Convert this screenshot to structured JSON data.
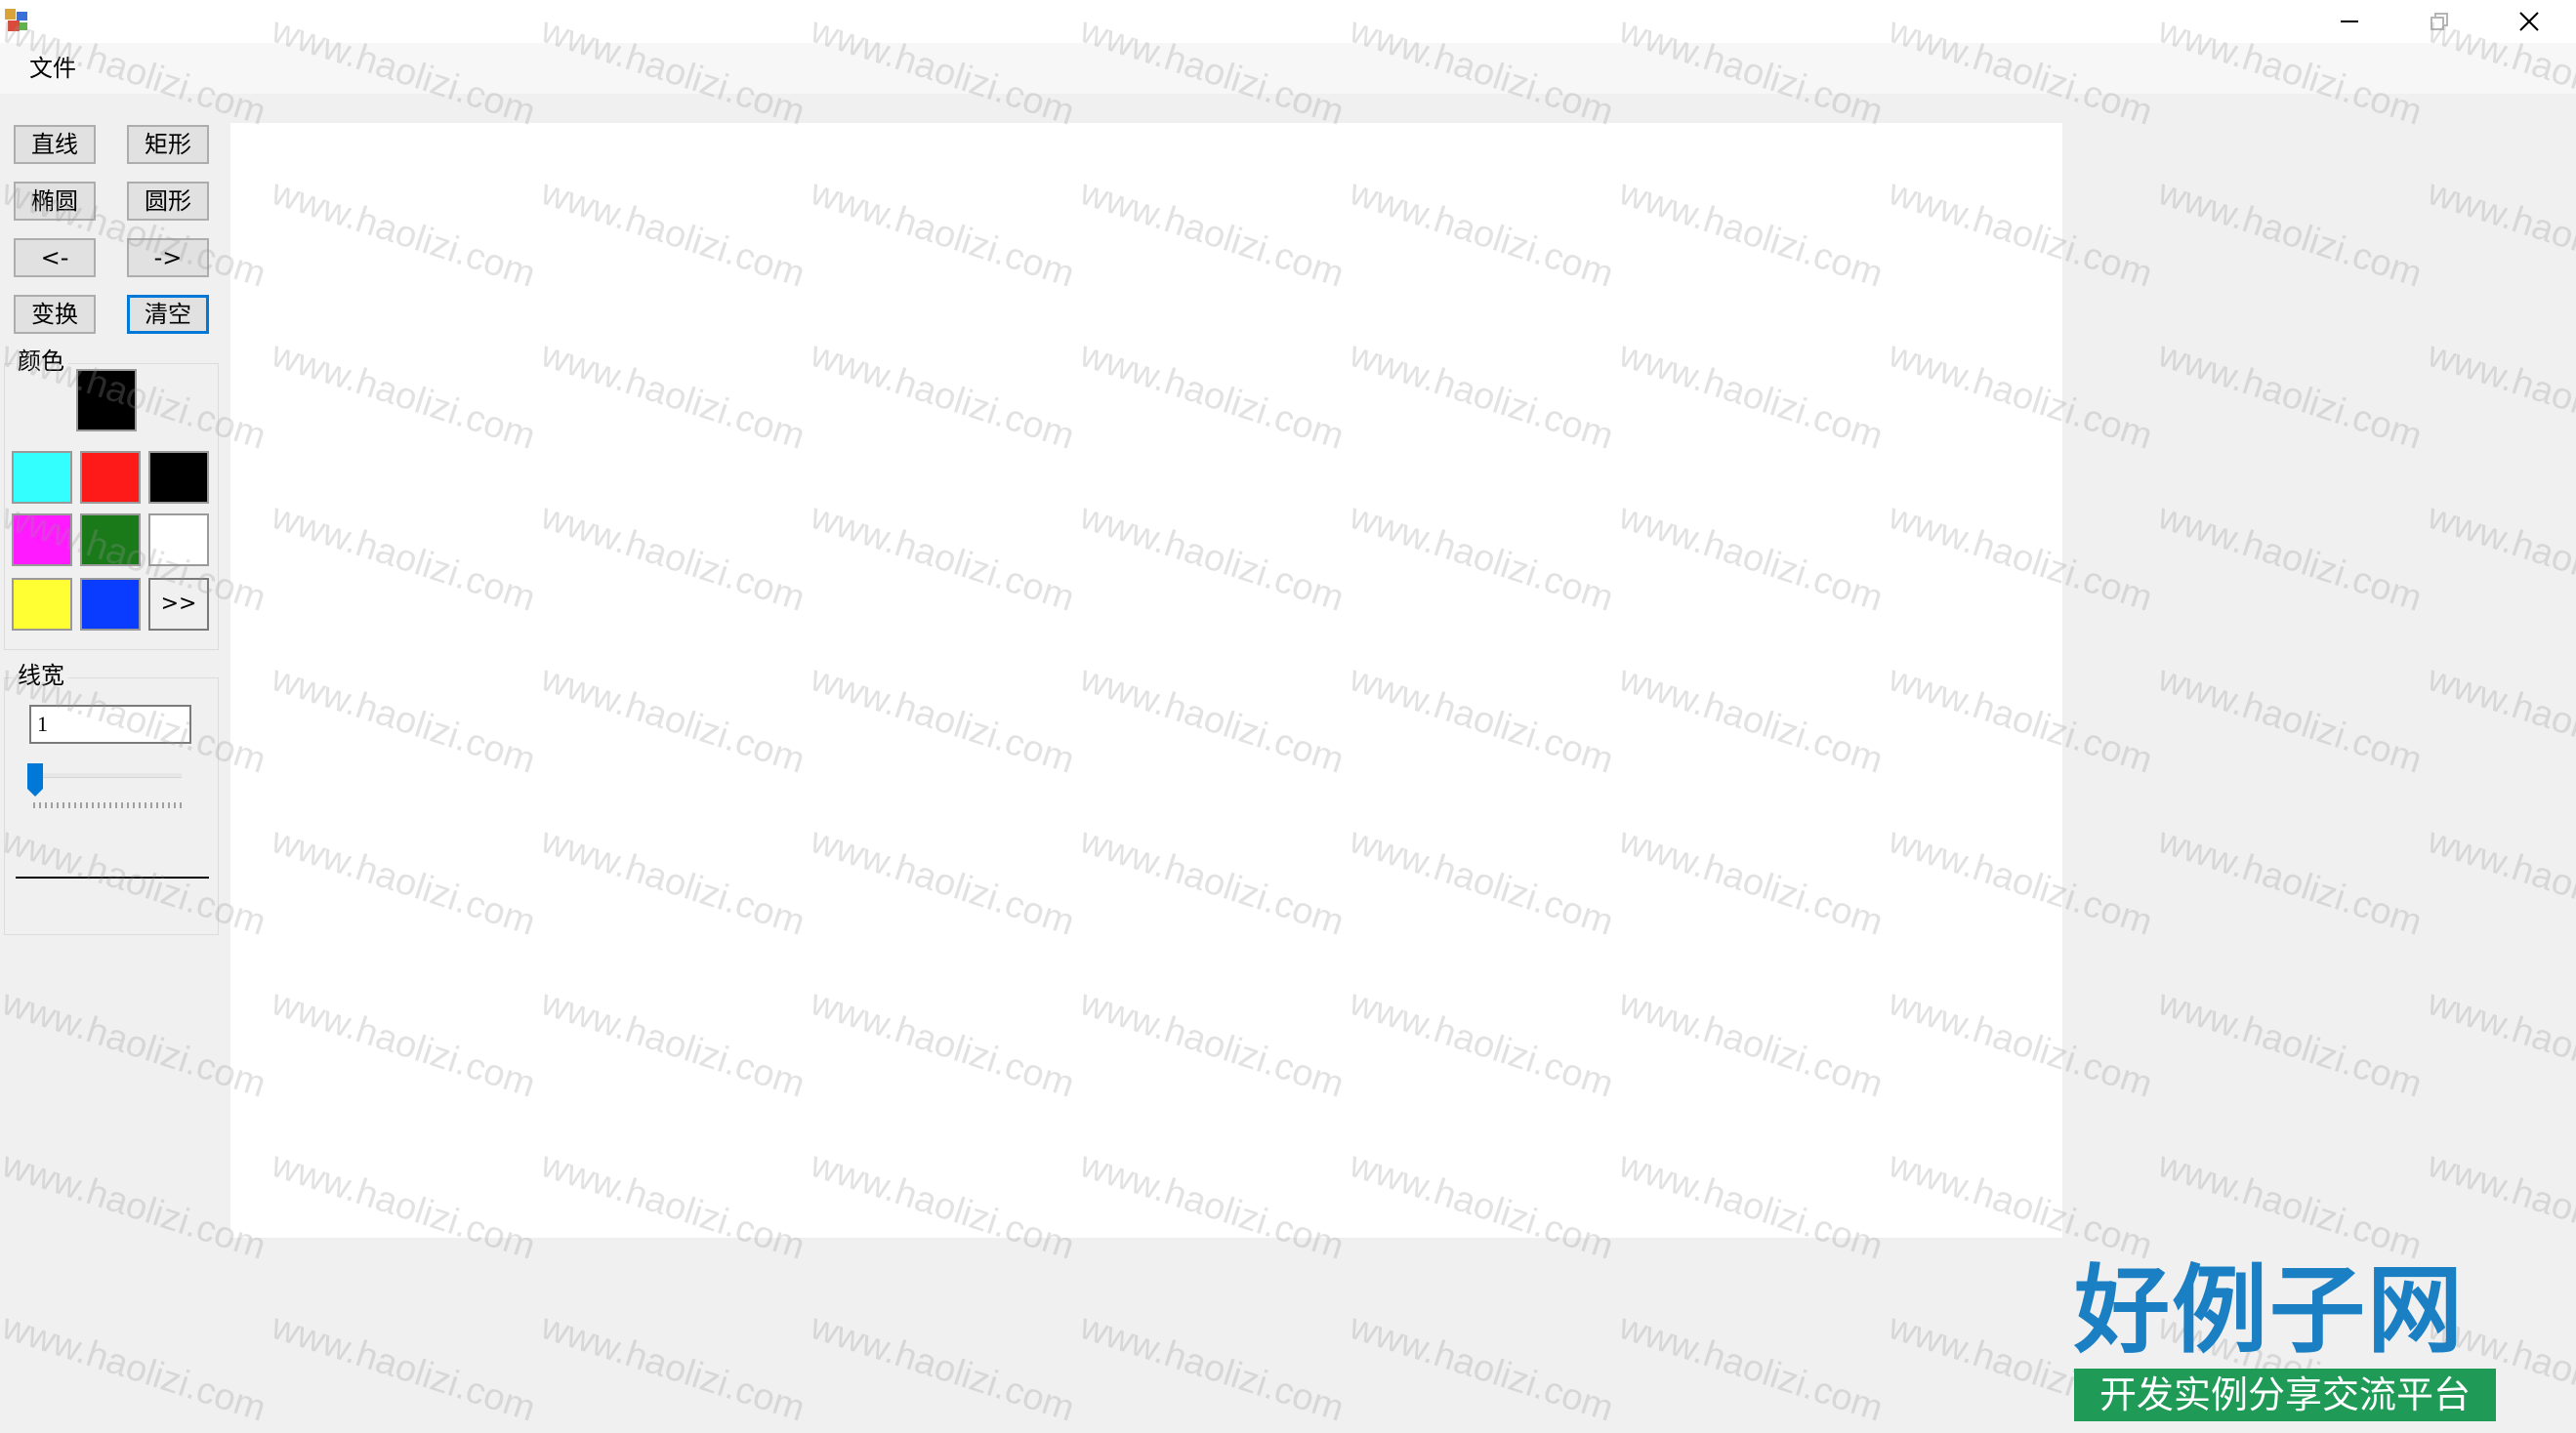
{
  "window": {
    "minimize_glyph": "minimize-icon",
    "maximize_glyph": "restore-icon",
    "close_glyph": "close-icon"
  },
  "menu": {
    "items": [
      {
        "label": "文件"
      }
    ]
  },
  "toolbar": {
    "buttons": [
      {
        "label": "直线"
      },
      {
        "label": "矩形"
      },
      {
        "label": "椭圆"
      },
      {
        "label": "圆形"
      },
      {
        "label": "<-"
      },
      {
        "label": "->"
      },
      {
        "label": "变换"
      },
      {
        "label": "清空"
      }
    ]
  },
  "color_panel": {
    "label": "颜色",
    "current_color": "#000000",
    "swatches": [
      "#33ffff",
      "#ff1a1a",
      "#000000",
      "#ff1aff",
      "#1a7a1a",
      "#ffffff",
      "#ffff33",
      "#0a3cff"
    ],
    "more_label": ">>"
  },
  "width_panel": {
    "label": "线宽",
    "value": "1",
    "slider_level": 0.0
  },
  "watermark": {
    "text": "www.haolizi.com",
    "logo_title": "好例子网",
    "logo_subtitle": "开发实例分享交流平台"
  }
}
